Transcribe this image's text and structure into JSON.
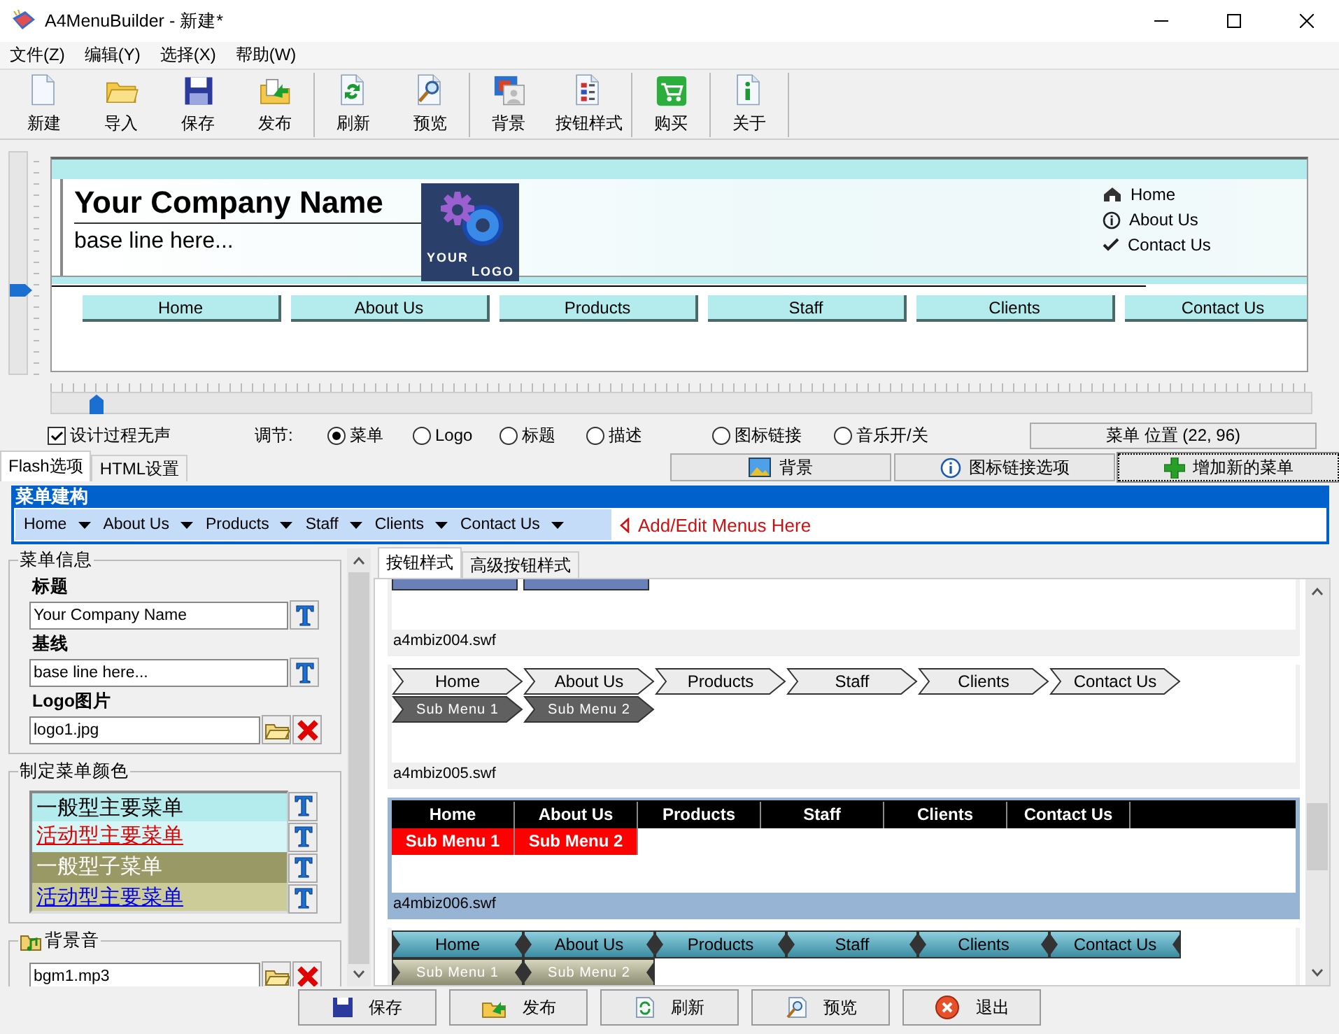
{
  "window": {
    "title": "A4MenuBuilder - 新建*"
  },
  "menu_bar": [
    "文件(Z)",
    "编辑(Y)",
    "选择(X)",
    "帮助(W)"
  ],
  "toolbar": {
    "groups": [
      [
        "新建",
        "导入",
        "保存",
        "发布"
      ],
      [
        "刷新",
        "预览"
      ],
      [
        "背景",
        "按钮样式"
      ],
      [
        "购买"
      ],
      [
        "关于"
      ]
    ]
  },
  "preview": {
    "company_name": "Your Company Name",
    "baseline": "base line here...",
    "logo": [
      "YOUR",
      "LOGO"
    ],
    "top_links": [
      "Home",
      "About Us",
      "Contact Us"
    ],
    "nav": [
      "Home",
      "About Us",
      "Products",
      "Staff",
      "Clients",
      "Contact Us"
    ],
    "horizontal_slider": {
      "level": 0.03
    }
  },
  "options": {
    "silent": {
      "label": "设计过程无声",
      "checked": true
    },
    "adjust_label": "调节:",
    "radios": [
      {
        "label": "菜单",
        "selected": true
      },
      {
        "label": "Logo",
        "selected": false
      },
      {
        "label": "标题",
        "selected": false
      },
      {
        "label": "描述",
        "selected": false
      },
      {
        "label": "图标链接",
        "selected": false
      },
      {
        "label": "音乐开/关",
        "selected": false
      }
    ],
    "position": "菜单 位置 (22, 96)"
  },
  "tabs": [
    {
      "label": "Flash选项",
      "selected": true
    },
    {
      "label": "HTML设置",
      "selected": false
    }
  ],
  "actions": [
    "背景",
    "图标链接选项",
    "增加新的菜单"
  ],
  "menu_structure": {
    "title": "菜单建构",
    "items": [
      "Home",
      "About Us",
      "Products",
      "Staff",
      "Clients",
      "Contact Us"
    ],
    "hint": "Add/Edit Menus Here"
  },
  "menu_info": {
    "title": "菜单信息",
    "fields": [
      {
        "label": "标题",
        "value": "Your Company Name",
        "kind": "text"
      },
      {
        "label": "基线",
        "value": "base line here...",
        "kind": "text"
      },
      {
        "label": "Logo图片",
        "value": "logo1.jpg",
        "kind": "file"
      }
    ]
  },
  "menu_colors": {
    "title": "制定菜单颜色",
    "rows": [
      {
        "label": "一般型主要菜单",
        "kind": "main_normal",
        "color": "#b4ecee"
      },
      {
        "label": "活动型主要菜单",
        "kind": "main_active",
        "color": "#d6f5f6"
      },
      {
        "label": "一般型子菜单",
        "kind": "sub_normal",
        "color": "#999966"
      },
      {
        "label": "活动型主要菜单",
        "kind": "sub_active",
        "color": "#cccc99"
      }
    ]
  },
  "music": {
    "title": "背景音",
    "value": "bgm1.mp3"
  },
  "style_tabs": [
    {
      "label": "按钮样式",
      "selected": true
    },
    {
      "label": "高级按钮样式",
      "selected": false
    }
  ],
  "styles": [
    {
      "kind": "cut",
      "file": "a4mbiz004.swf",
      "selected": false
    },
    {
      "kind": "arrow",
      "file": "a4mbiz005.swf",
      "selected": false,
      "main": [
        "Home",
        "About Us",
        "Products",
        "Staff",
        "Clients",
        "Contact Us"
      ],
      "sub": [
        "Sub Menu 1",
        "Sub Menu 2"
      ]
    },
    {
      "kind": "flat",
      "file": "a4mbiz006.swf",
      "selected": true,
      "main": [
        "Home",
        "About Us",
        "Products",
        "Staff",
        "Clients",
        "Contact Us"
      ],
      "sub": [
        "Sub Menu 1",
        "Sub Menu 2"
      ]
    },
    {
      "kind": "bevel",
      "selected": false,
      "main": [
        "Home",
        "About Us",
        "Products",
        "Staff",
        "Clients",
        "Contact Us"
      ],
      "sub": [
        "Sub Menu 1",
        "Sub Menu 2"
      ]
    }
  ],
  "bottom_buttons": [
    "保存",
    "发布",
    "刷新",
    "预览",
    "退出"
  ]
}
